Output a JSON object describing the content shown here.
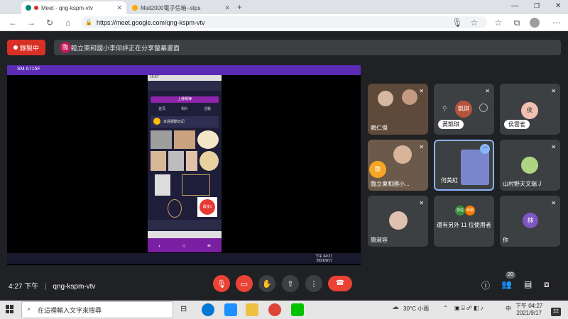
{
  "browser": {
    "tabs": [
      {
        "title": "Meet - qng-kspm-vtv",
        "active": true
      },
      {
        "title": "Mail2000電子信箱--stps",
        "active": false
      }
    ],
    "url": "https://meet.google.com/qng-kspm-vtv"
  },
  "meet": {
    "recording_label": "錄製中",
    "presenter_text": "臨立東和國小李仰評正在分享螢幕畫面",
    "presenter_initial": "臨",
    "share_window_title": "SM A715F",
    "share_phone": {
      "time": "10:57",
      "button": "上傳相簿",
      "tabs": [
        "首頁",
        "相片",
        "活動"
      ],
      "item_title": "本週運動日記",
      "fab": "最後1",
      "taskbar_time": "下午 04:27",
      "taskbar_date": "2021/9/17"
    },
    "participants": [
      {
        "name": "賴仁傑"
      },
      {
        "name": "黃凱琪",
        "avatar_text": "凱琪"
      },
      {
        "name": "侯雲雀",
        "avatar_text": "侯"
      },
      {
        "name": "臨立東和國小...",
        "avatar_text": "臨"
      },
      {
        "name": "何美紅"
      },
      {
        "name": "山村野夫文瑞 J"
      },
      {
        "name": "簡淑容"
      },
      {
        "name": "還有另外 11 位使用者",
        "avatar1": "曾信",
        "avatar2": "幸潔"
      },
      {
        "name": "你",
        "avatar_text": "林"
      }
    ],
    "meeting_time": "4:27 下午",
    "meeting_code": "qng-kspm-vtv",
    "people_count": "20"
  },
  "windows": {
    "search_placeholder": "在這裡輸入文字來搜尋",
    "weather": "30°C 小雨",
    "time": "下午 04:27",
    "date": "2021/9/17",
    "ime": "中",
    "notif_count": "22"
  },
  "colors": {
    "accent": "#8ab4f8",
    "danger": "#ea4335",
    "purple": "#5b2bb5"
  }
}
